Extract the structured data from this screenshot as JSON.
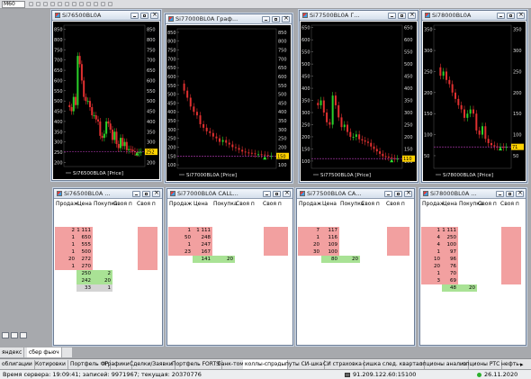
{
  "toolbar": {
    "timeframe": "M60"
  },
  "chart_windows": [
    {
      "title": "Si76500BL0A",
      "legend": "Si76500BL0A [Price]",
      "ticks": [
        "850",
        "800",
        "750",
        "700",
        "650",
        "600",
        "550",
        "500",
        "450",
        "400",
        "350",
        "300",
        "250",
        "200"
      ],
      "last_price": "252",
      "chart_data": {
        "type": "candlestick",
        "series": [
          {
            "name": "Si76500BL0A [Price]",
            "values": [
              480,
              470,
              450,
              520,
              480,
              720,
              680,
              600,
              520,
              500,
              500,
              470,
              430,
              430,
              410,
              400,
              330,
              320,
              340,
              400,
              390,
              360,
              310,
              350,
              290,
              270,
              320,
              280,
              300,
              260,
              265,
              262,
              255,
              250,
              245,
              250,
              252
            ]
          }
        ],
        "ylim": [
          180,
          870
        ]
      }
    },
    {
      "title": "Si77000BL0A Граф...",
      "legend": "Si77000BL0A [Price]",
      "ticks": [
        "850",
        "800",
        "750",
        "700",
        "650",
        "600",
        "550",
        "500",
        "450",
        "400",
        "350",
        "300",
        "250",
        "200",
        "150",
        "100"
      ],
      "last_price": "150",
      "chart_data": {
        "type": "candlestick",
        "series": [
          {
            "name": "Si77000BL0A [Price]",
            "values": [
              560,
              520,
              480,
              430,
              400,
              380,
              330,
              310,
              290,
              280,
              260,
              250,
              230,
              240,
              225,
              215,
              200,
              195,
              185,
              175,
              170,
              168,
              165,
              160,
              160,
              158,
              155,
              150,
              150
            ]
          }
        ],
        "ylim": [
          80,
          870
        ]
      }
    },
    {
      "title": "Si77500BL0A Г...",
      "legend": "Si77500BL0A [Price]",
      "ticks": [
        "650",
        "600",
        "550",
        "500",
        "450",
        "400",
        "350",
        "300",
        "250",
        "200",
        "150",
        "100"
      ],
      "last_price": "110",
      "chart_data": {
        "type": "candlestick",
        "series": [
          {
            "name": "Si77500BL0A [Price]",
            "values": [
              340,
              330,
              350,
              300,
              260,
              250,
              370,
              330,
              280,
              240,
              250,
              220,
              200,
              200,
              210,
              190,
              185,
              180,
              175,
              160,
              150,
              140,
              130,
              120,
              118,
              115,
              112,
              110,
              110
            ]
          }
        ],
        "ylim": [
          70,
          660
        ]
      }
    },
    {
      "title": "Si78000BL0A",
      "legend": "Si78000BL0A [Price]",
      "ticks": [
        "350",
        "300",
        "250",
        "200",
        "150",
        "100",
        "50"
      ],
      "last_price": "71",
      "chart_data": {
        "type": "candlestick",
        "series": [
          {
            "name": "Si78000BL0A [Price]",
            "values": [
              260,
              240,
              250,
              230,
              220,
              200,
              185,
              170,
              160,
              140,
              150,
              160,
              150,
              110,
              100,
              120,
              90,
              80,
              75,
              72,
              71,
              71,
              70,
              71
            ]
          }
        ],
        "ylim": [
          20,
          360
        ]
      }
    }
  ],
  "depth_windows": [
    {
      "title": "Si76500BL0A ...",
      "headers": [
        "Продаж",
        "Цена",
        "Покупка",
        "Своя п",
        "Своя п"
      ],
      "rows": [
        {
          "sell": "2",
          "price": "1 111"
        },
        {
          "sell": "1",
          "price": "650"
        },
        {
          "sell": "1",
          "price": "555"
        },
        {
          "sell": "1",
          "price": "500"
        },
        {
          "sell": "20",
          "price": "272"
        },
        {
          "sell": "1",
          "price": "270"
        },
        {
          "price": "250",
          "buy": "2"
        },
        {
          "price": "242",
          "buy": "20"
        },
        {
          "price": "33",
          "buy": "1"
        }
      ]
    },
    {
      "title": "Si77000BL0A CALL...",
      "headers": [
        "Продаж",
        "Цена",
        "Покупка",
        "Своя п",
        "Своя п"
      ],
      "rows": [
        {
          "sell": "1",
          "price": "1 111"
        },
        {
          "sell": "50",
          "price": "248"
        },
        {
          "sell": "1",
          "price": "247"
        },
        {
          "sell": "23",
          "price": "167"
        },
        {
          "price": "141",
          "buy": "20"
        }
      ]
    },
    {
      "title": "Si77500BL0A CA...",
      "headers": [
        "Продаж",
        "Цена",
        "Покупка",
        "Своя п",
        "Своя п"
      ],
      "rows": [
        {
          "sell": "7",
          "price": "117"
        },
        {
          "sell": "1",
          "price": "116"
        },
        {
          "sell": "20",
          "price": "109"
        },
        {
          "sell": "30",
          "price": "100"
        },
        {
          "price": "80",
          "buy": "20"
        }
      ]
    },
    {
      "title": "Si78000BL0A ...",
      "headers": [
        "Продаж",
        "Цена",
        "Покупка",
        "Своя п",
        "Своя п"
      ],
      "rows": [
        {
          "sell": "1",
          "price": "1 111"
        },
        {
          "sell": "4",
          "price": "250"
        },
        {
          "sell": "4",
          "price": "100"
        },
        {
          "sell": "1",
          "price": "97"
        },
        {
          "sell": "10",
          "price": "96"
        },
        {
          "sell": "20",
          "price": "76"
        },
        {
          "sell": "1",
          "price": "70"
        },
        {
          "sell": "3",
          "price": "69"
        },
        {
          "price": "48",
          "buy": "20"
        }
      ]
    }
  ],
  "upper_tabs": [
    "яндекс",
    "сбер фьюч"
  ],
  "bottom_tabs": [
    "облигации",
    "Котировки",
    "Портфель ФР",
    "Графики",
    "Сделки/Заявки",
    "Портфель FORTS",
    "банк-том",
    "коллы-спрэды",
    "путы СИ-шка",
    "СИ страховка",
    "сишка след. квартал",
    "опционы анализ",
    "опционы РТС",
    "нефть-"
  ],
  "status": {
    "server_time": "Время сервера: 19:09:41; записей: 9971967; текущая: 20370776",
    "server_addr": "91.209.122.60:15100",
    "date": "26.11.2020"
  }
}
